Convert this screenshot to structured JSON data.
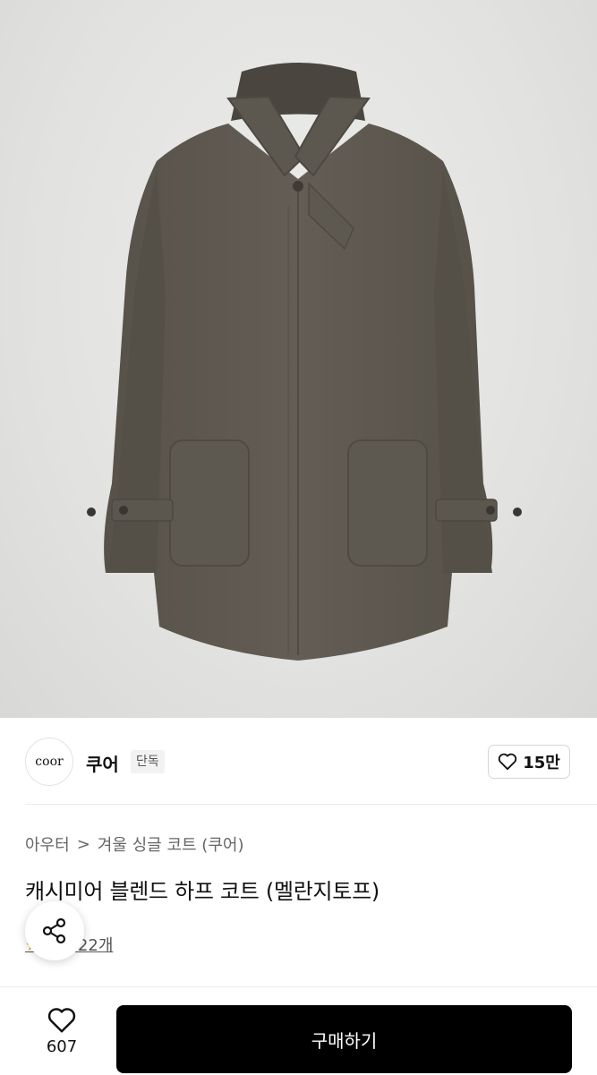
{
  "product_image": {
    "subject": "coat-photo"
  },
  "brand": {
    "logo_text": "coor",
    "name": "쿠어",
    "badge": "단독",
    "likes": "15만"
  },
  "breadcrumb": {
    "category": "아우터",
    "separator": ">",
    "subcategory": "겨울 싱글 코트 (쿠어)"
  },
  "product": {
    "title": "캐시미어 블렌드 하프 코트 (멜란지토프)",
    "review_text": "후기 22개"
  },
  "bottom_bar": {
    "wish_count": "607",
    "buy_label": "구매하기"
  },
  "colors": {
    "coat": "#5f5a53",
    "buy_button": "#000000"
  }
}
